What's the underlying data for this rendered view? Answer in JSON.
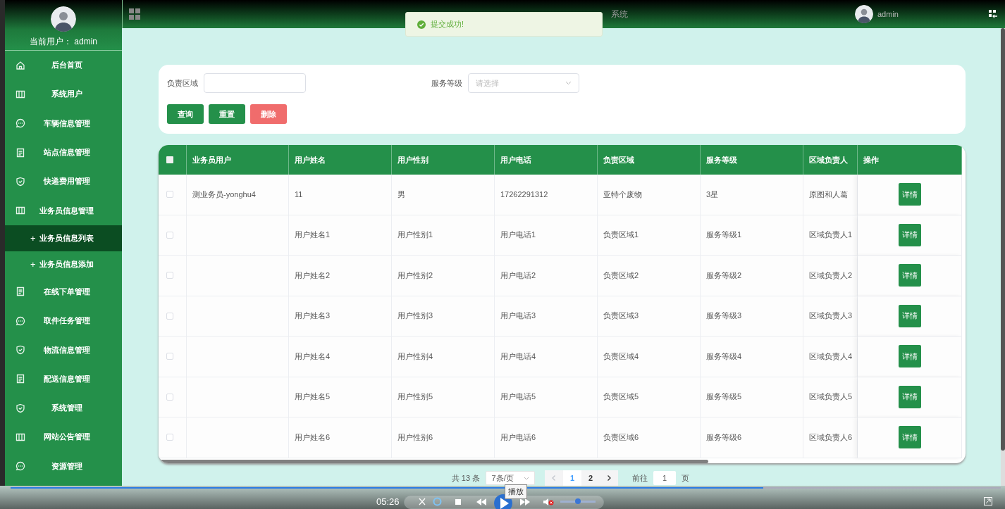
{
  "sidebar": {
    "user_label": "当前用户： admin",
    "items": [
      {
        "kind": "home",
        "label": "后台首页"
      },
      {
        "kind": "columns",
        "label": "系统用户"
      },
      {
        "kind": "chat",
        "label": "车辆信息管理"
      },
      {
        "kind": "doc",
        "label": "站点信息管理"
      },
      {
        "kind": "shield",
        "label": "快递费用管理"
      },
      {
        "kind": "columns",
        "label": "业务员信息管理",
        "children": [
          {
            "marker": "+",
            "label": "业务员信息列表",
            "selected": true
          },
          {
            "marker": "+",
            "label": "业务员信息添加",
            "selected": false
          }
        ]
      },
      {
        "kind": "doc",
        "label": "在线下单管理"
      },
      {
        "kind": "chat",
        "label": "取件任务管理"
      },
      {
        "kind": "shield",
        "label": "物流信息管理"
      },
      {
        "kind": "doc",
        "label": "配送信息管理"
      },
      {
        "kind": "shield",
        "label": "系统管理"
      },
      {
        "kind": "columns",
        "label": "网站公告管理"
      },
      {
        "kind": "chat",
        "label": "资源管理"
      }
    ]
  },
  "header": {
    "title": "系统",
    "user": "admin"
  },
  "toast": {
    "message": "提交成功!"
  },
  "filters": [
    {
      "label": "负责区域",
      "kind": "input"
    },
    {
      "label": "服务等级",
      "kind": "select",
      "placeholder": "请选择"
    }
  ],
  "buttons": [
    {
      "label": "查询",
      "kind": "primary"
    },
    {
      "label": "重置",
      "kind": "primary"
    },
    {
      "label": "删除",
      "kind": "danger"
    }
  ],
  "table": {
    "all_checked": false,
    "columns": [
      "业务员用户",
      "用户姓名",
      "用户性别",
      "用户电话",
      "负责区域",
      "服务等级",
      "区域负责人",
      "操作"
    ],
    "rows": [
      {
        "checked": false,
        "cells": [
          "测业务员-yonghu4",
          "11",
          "男",
          "17262291312",
          "亚特个废物",
          "3星",
          "原图和人葛"
        ],
        "action": "详情"
      },
      {
        "checked": false,
        "cells": [
          "",
          "用户姓名1",
          "用户性别1",
          "用户电话1",
          "负责区域1",
          "服务等级1",
          "区域负责人1"
        ],
        "action": "详情"
      },
      {
        "checked": false,
        "cells": [
          "",
          "用户姓名2",
          "用户性别2",
          "用户电话2",
          "负责区域2",
          "服务等级2",
          "区域负责人2"
        ],
        "action": "详情"
      },
      {
        "checked": false,
        "cells": [
          "",
          "用户姓名3",
          "用户性别3",
          "用户电话3",
          "负责区域3",
          "服务等级3",
          "区域负责人3"
        ],
        "action": "详情"
      },
      {
        "checked": false,
        "cells": [
          "",
          "用户姓名4",
          "用户性别4",
          "用户电话4",
          "负责区域4",
          "服务等级4",
          "区域负责人4"
        ],
        "action": "详情"
      },
      {
        "checked": false,
        "cells": [
          "",
          "用户姓名5",
          "用户性别5",
          "用户电话5",
          "负责区域5",
          "服务等级5",
          "区域负责人5"
        ],
        "action": "详情"
      },
      {
        "checked": false,
        "cells": [
          "",
          "用户姓名6",
          "用户性别6",
          "用户电话6",
          "负责区域6",
          "服务等级6",
          "区域负责人6"
        ],
        "action": "详情"
      }
    ]
  },
  "pagination": {
    "total": "共 13 条",
    "page_size": "7条/页",
    "pages": [
      {
        "label": "1",
        "selected": true
      },
      {
        "label": "2",
        "selected": false
      }
    ],
    "goto_label": "前往",
    "goto_value": "1",
    "goto_suffix": "页"
  },
  "player": {
    "time": "05:26",
    "tooltip": "播放",
    "muted": true,
    "progress": {
      "level": 0.76
    },
    "volume": {
      "level": 0.5
    }
  }
}
